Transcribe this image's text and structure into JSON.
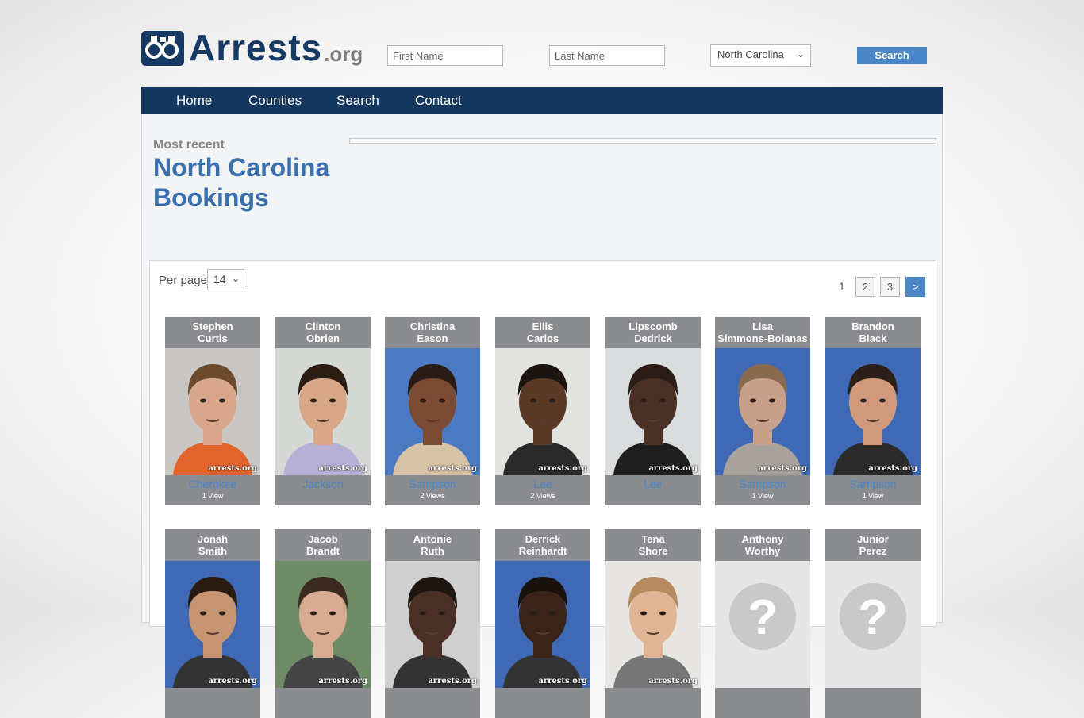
{
  "brand": {
    "name": "Arrests",
    "tld": ".org"
  },
  "search": {
    "first_placeholder": "First Name",
    "last_placeholder": "Last Name",
    "state_selected": "North Carolina",
    "button": "Search"
  },
  "nav": {
    "items": [
      "Home",
      "Counties",
      "Search",
      "Contact"
    ]
  },
  "page": {
    "kicker": "Most recent",
    "title": "North Carolina Bookings"
  },
  "listing": {
    "per_page_label": "Per page",
    "per_page_value": "14",
    "pages": [
      "1",
      "2",
      "3"
    ],
    "next": ">"
  },
  "watermark": "arrests.org",
  "cards": [
    {
      "first": "Stephen",
      "last": "Curtis",
      "county": "Cherokee",
      "views": "1 View",
      "bg": "#c9c7c4",
      "skin": "#d9a78c",
      "hair": "#6b4a2e",
      "shirt": "#e2642c"
    },
    {
      "first": "Clinton",
      "last": "Obrien",
      "county": "Jackson",
      "views": "",
      "bg": "#d6d8d5",
      "skin": "#d7a787",
      "hair": "#2b1d14",
      "shirt": "#b7b1d8"
    },
    {
      "first": "Christina",
      "last": "Eason",
      "county": "Sampson",
      "views": "2 Views",
      "bg": "#4b79c2",
      "skin": "#7a4a33",
      "hair": "#2a1c14",
      "shirt": "#d6c2a6"
    },
    {
      "first": "Ellis",
      "last": "Carlos",
      "county": "Lee",
      "views": "2 Views",
      "bg": "#e2e2df",
      "skin": "#5a3a27",
      "hair": "#1c1410",
      "shirt": "#2a2a2a"
    },
    {
      "first": "Lipscomb",
      "last": "Dedrick",
      "county": "Lee",
      "views": "",
      "bg": "#d9dcdc",
      "skin": "#4a3024",
      "hair": "#2a1d16",
      "shirt": "#1e1e1e"
    },
    {
      "first": "Lisa",
      "last": "Simmons-Bolanas",
      "county": "Sampson",
      "views": "1 View",
      "bg": "#3f69b4",
      "skin": "#c9a089",
      "hair": "#8a6a4e",
      "shirt": "#a7a29c"
    },
    {
      "first": "Brandon",
      "last": "Black",
      "county": "Sampson",
      "views": "1 View",
      "bg": "#3f69b4",
      "skin": "#d19a7c",
      "hair": "#2b1f18",
      "shirt": "#2a2a2a"
    },
    {
      "first": "Jonah",
      "last": "Smith",
      "county": "",
      "views": "",
      "bg": "#3f69b4",
      "skin": "#c79472",
      "hair": "#2a1b12",
      "shirt": "#333333"
    },
    {
      "first": "Jacob",
      "last": "Brandt",
      "county": "",
      "views": "",
      "bg": "#6e8a66",
      "skin": "#d8ab93",
      "hair": "#3a2a20",
      "shirt": "#444444"
    },
    {
      "first": "Antonie",
      "last": "Ruth",
      "county": "",
      "views": "",
      "bg": "#cfcfcf",
      "skin": "#4a3024",
      "hair": "#1e1510",
      "shirt": "#333333"
    },
    {
      "first": "Derrick",
      "last": "Reinhardt",
      "county": "",
      "views": "",
      "bg": "#3f69b4",
      "skin": "#3a2419",
      "hair": "#1a120e",
      "shirt": "#333333"
    },
    {
      "first": "Tena",
      "last": "Shore",
      "county": "",
      "views": "",
      "bg": "#e8e6e2",
      "skin": "#e0b596",
      "hair": "#b58a5e",
      "shirt": "#777777"
    },
    {
      "first": "Anthony",
      "last": "Worthy",
      "county": "",
      "views": "",
      "bg": "#e6e6e6",
      "skin": "",
      "hair": "",
      "shirt": "",
      "placeholder": "?"
    },
    {
      "first": "Junior",
      "last": "Perez",
      "county": "",
      "views": "",
      "bg": "#e6e6e6",
      "skin": "",
      "hair": "",
      "shirt": "",
      "placeholder": "?"
    }
  ]
}
